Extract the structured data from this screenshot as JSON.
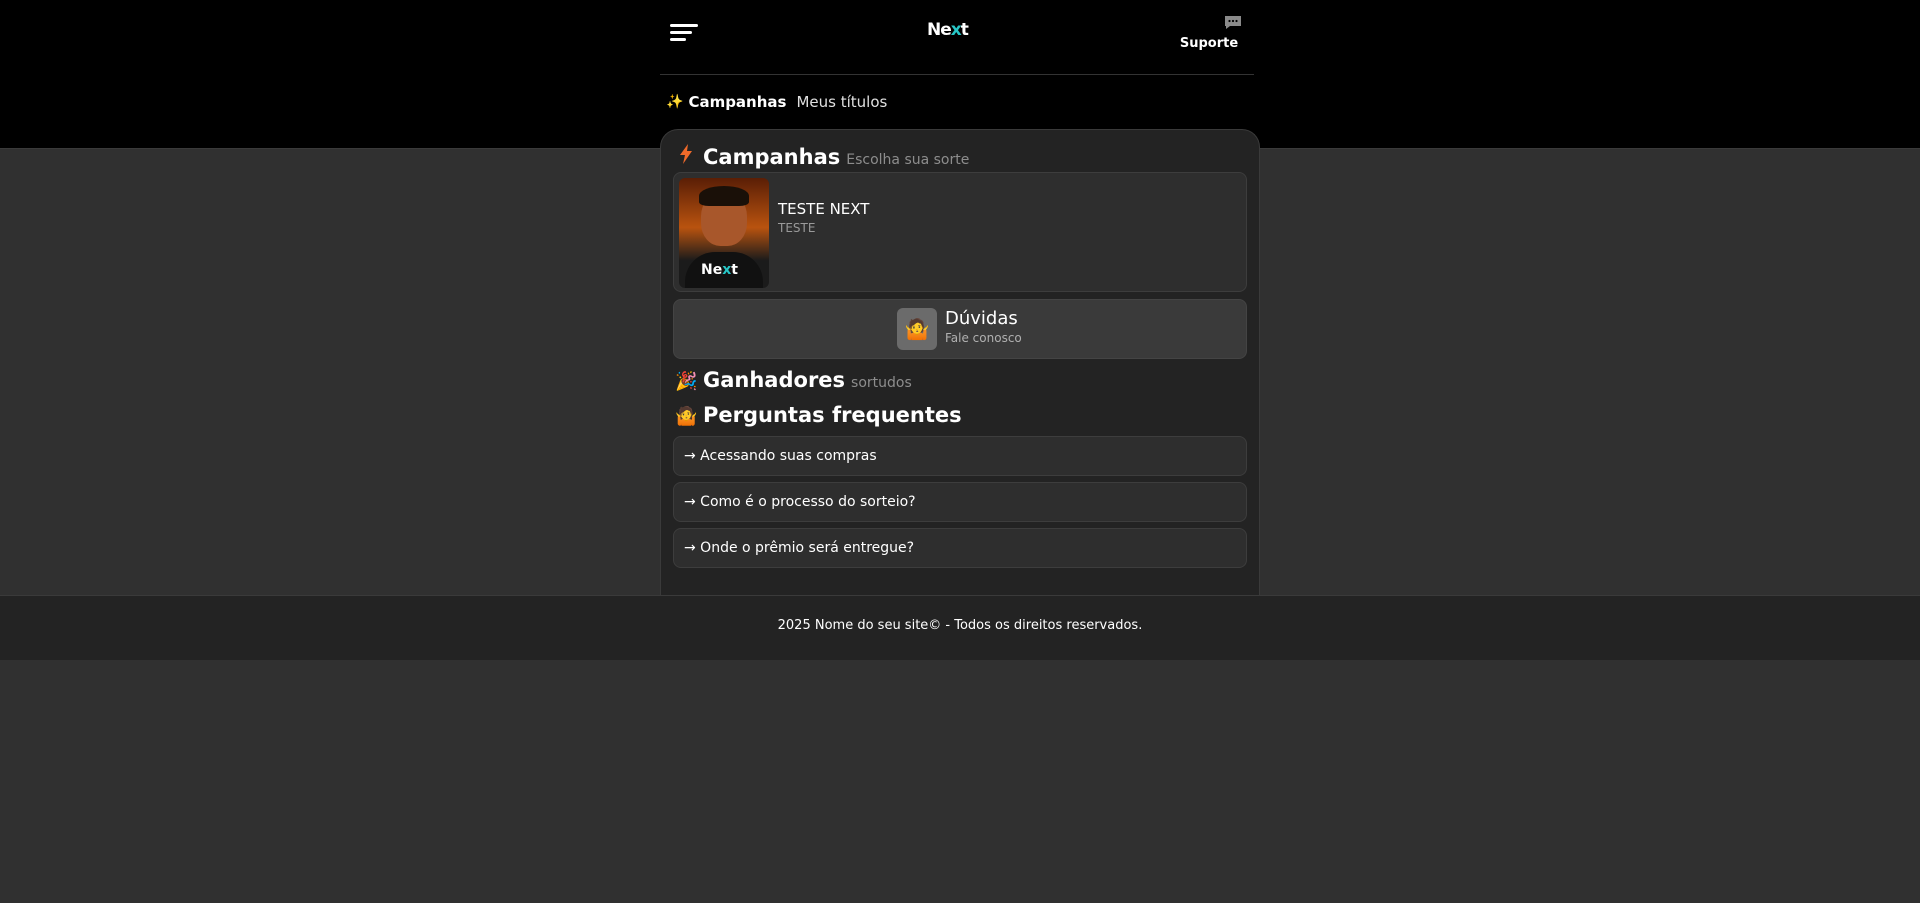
{
  "header": {
    "logo_main": "Ne",
    "logo_accent": "x",
    "logo_end": "t",
    "support_label": "Suporte"
  },
  "nav": {
    "active_label": "Campanhas",
    "link_label": "Meus títulos"
  },
  "campaigns_section": {
    "title": "Campanhas",
    "subtitle": "Escolha sua sorte"
  },
  "campaign": {
    "title": "TESTE NEXT",
    "subtitle": "TESTE",
    "shirt_logo_main": "Ne",
    "shirt_logo_accent": "x",
    "shirt_logo_end": "t"
  },
  "doubts": {
    "title": "Dúvidas",
    "subtitle": "Fale conosco"
  },
  "winners_section": {
    "title": "Ganhadores",
    "subtitle": "sortudos"
  },
  "faq_section": {
    "title": "Perguntas frequentes",
    "items": [
      "→ Acessando suas compras",
      "→ Como é o processo do sorteio?",
      "→ Onde o prêmio será entregue?"
    ]
  },
  "footer": {
    "text": "2025 Nome do seu site© - Todos os direitos reservados."
  },
  "icons": {
    "menu": "menu-icon",
    "chat": "chat-icon",
    "sparkle": "sparkle-icon",
    "lightning": "lightning-icon",
    "party": "party-popper-icon",
    "shrug": "shrug-icon"
  }
}
